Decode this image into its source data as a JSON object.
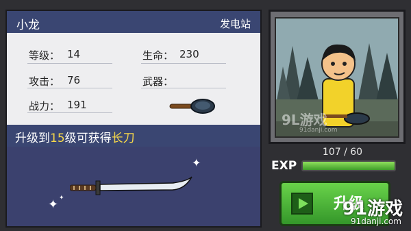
{
  "character": {
    "name": "小龙",
    "location": "发电站"
  },
  "stats": {
    "level_label": "等级：",
    "level_value": "14",
    "hp_label": "生命：",
    "hp_value": "230",
    "attack_label": "攻击：",
    "attack_value": "76",
    "weapon_label": "武器：",
    "power_label": "战力：",
    "power_value": "191"
  },
  "upgrade": {
    "prefix": "升级到",
    "level": "15",
    "middle": "级可获得",
    "reward": "长刀"
  },
  "exp": {
    "label": "EXP",
    "text": "107 / 60",
    "fill_fraction": 1.0
  },
  "button": {
    "label": "升级"
  },
  "watermark": {
    "logo_text": "91游戏",
    "url": "91danji.com",
    "portrait_mark": "9L游戏",
    "portrait_url": "91danji.com"
  },
  "colors": {
    "panel_header": "#3a4672",
    "highlight": "#f7d84a",
    "exp_fill": "#6fc84a",
    "button": "#4fb838"
  },
  "icons": {
    "weapon_current": "frying-pan-icon",
    "reward_weapon": "katana-icon"
  }
}
